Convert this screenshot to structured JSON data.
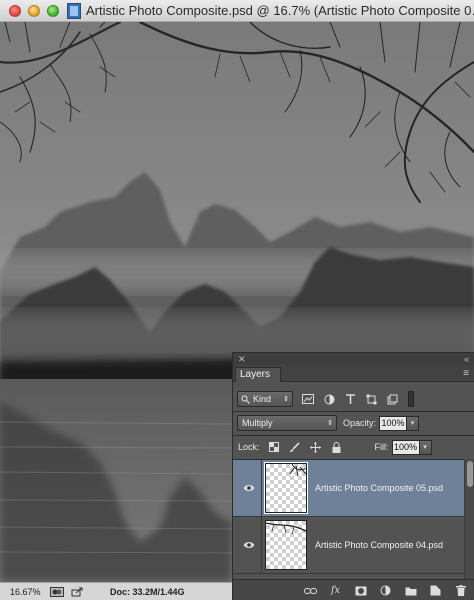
{
  "window": {
    "title": "Artistic Photo Composite.psd @ 16.7% (Artistic Photo Composite 0…"
  },
  "statusbar": {
    "zoom": "16.67%",
    "doc_info": "Doc: 33.2M/1.44G"
  },
  "layers_panel": {
    "tab_label": "Layers",
    "collapse_glyph": "«",
    "close_glyph": "✕",
    "menu_glyph": "≡",
    "filter": {
      "kind_label": "Kind"
    },
    "blend_mode": "Multiply",
    "opacity_label": "Opacity:",
    "opacity_value": "100%",
    "lock_label": "Lock:",
    "fill_label": "Fill:",
    "fill_value": "100%",
    "layers": [
      {
        "name": "Artistic Photo Composite 05.psd",
        "visible": true,
        "selected": true
      },
      {
        "name": "Artistic Photo Composite 04.psd",
        "visible": true,
        "selected": false
      }
    ],
    "bottom_fx_label": "fx"
  },
  "colors": {
    "selected_layer": "#6f8199",
    "panel_bg": "#535353",
    "canvas_sky": "#8a8a8a"
  }
}
